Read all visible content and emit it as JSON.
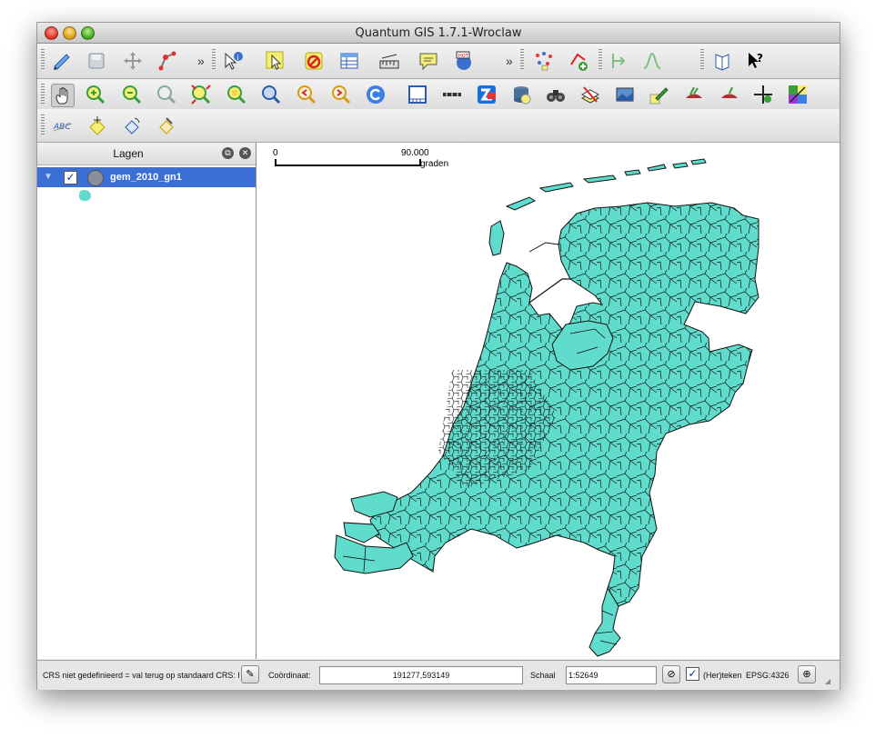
{
  "window": {
    "title": "Quantum GIS 1.7.1-Wroclaw"
  },
  "toolbar": {
    "overflow_label": "»"
  },
  "layers_panel": {
    "title": "Lagen",
    "layer_name": "gem_2010_gn1",
    "layer_checked": "✓"
  },
  "map": {
    "scale_bar_start": "0",
    "scale_bar_value": "90.000",
    "scale_bar_unit": "graden",
    "fill_color": "#5fdccc"
  },
  "status": {
    "crs_message": "CRS niet gedefinieerd = val terug op standaard CRS: E",
    "coord_label": "Coördinaat:",
    "coord_value": "191277,593149",
    "scale_label": "Schaal",
    "scale_value": "1:52649",
    "render_check": "✓",
    "render_label": "(Her)teken",
    "epsg": "EPSG:4326"
  }
}
